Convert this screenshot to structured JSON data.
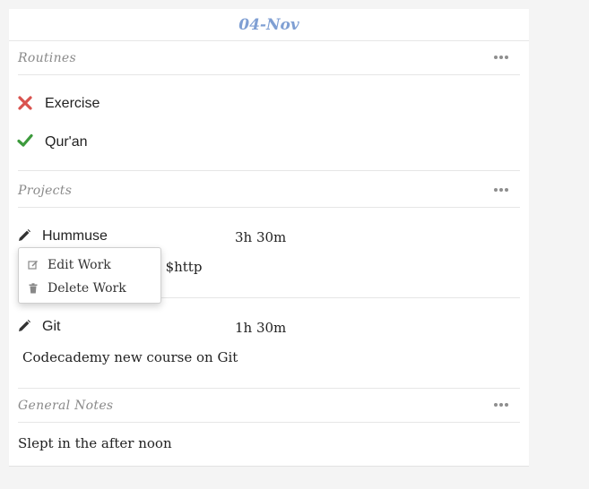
{
  "day": {
    "title": "04-Nov"
  },
  "routines": {
    "title": "Routines",
    "items": [
      {
        "name": "Exercise",
        "status": "missed",
        "icon": "cross-icon",
        "color": "#d9534f"
      },
      {
        "name": "Qur'an",
        "status": "done",
        "icon": "check-icon",
        "color": "#3c9a3c"
      }
    ]
  },
  "projects": {
    "title": "Projects",
    "items": [
      {
        "name": "Hummuse",
        "time": "3h 30m",
        "note_fragment": "l $http"
      },
      {
        "name": "Git",
        "time": "1h 30m",
        "note": "Codecademy new course on Git"
      }
    ]
  },
  "context_menu": {
    "edit_label": "Edit Work",
    "delete_label": "Delete Work"
  },
  "general_notes": {
    "title": "General Notes",
    "text": "Slept in the after noon"
  },
  "colors": {
    "accent": "#7f9fd3",
    "missed": "#d9534f",
    "done": "#3c9a3c"
  }
}
